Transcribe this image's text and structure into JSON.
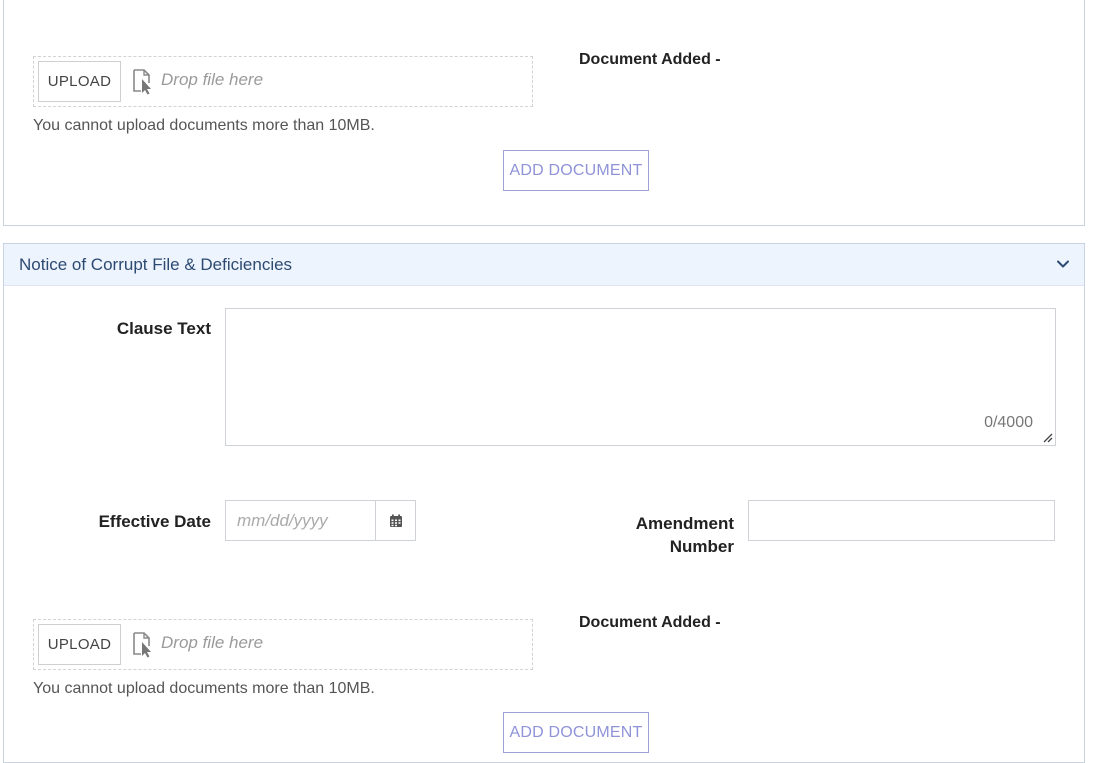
{
  "upload_section": {
    "upload_label": "UPLOAD",
    "drop_text": "Drop file here",
    "size_hint": "You cannot upload documents more than 10MB.",
    "document_added_label": "Document Added -",
    "add_document_label": "ADD DOCUMENT"
  },
  "notice_section": {
    "title": "Notice of Corrupt File & Deficiencies",
    "clause_text_label": "Clause Text",
    "clause_text_value": "",
    "clause_counter": "0/4000",
    "effective_date_label": "Effective Date",
    "effective_date_placeholder": "mm/dd/yyyy",
    "amendment_label_line1": "Amendment",
    "amendment_label_line2": "Number",
    "amendment_value": "",
    "upload_label": "UPLOAD",
    "drop_text": "Drop file here",
    "size_hint": "You cannot upload documents more than 10MB.",
    "document_added_label": "Document Added -",
    "add_document_label": "ADD DOCUMENT"
  },
  "colors": {
    "header_bg": "#eef4fd",
    "header_text": "#2c4a72",
    "accent_button": "#8f93d8",
    "border": "#c9d3e0"
  },
  "icons": {
    "file": "file-drop-icon",
    "chevron": "chevron-down-icon",
    "calendar": "calendar-icon",
    "resize": "resize-handle-icon"
  }
}
